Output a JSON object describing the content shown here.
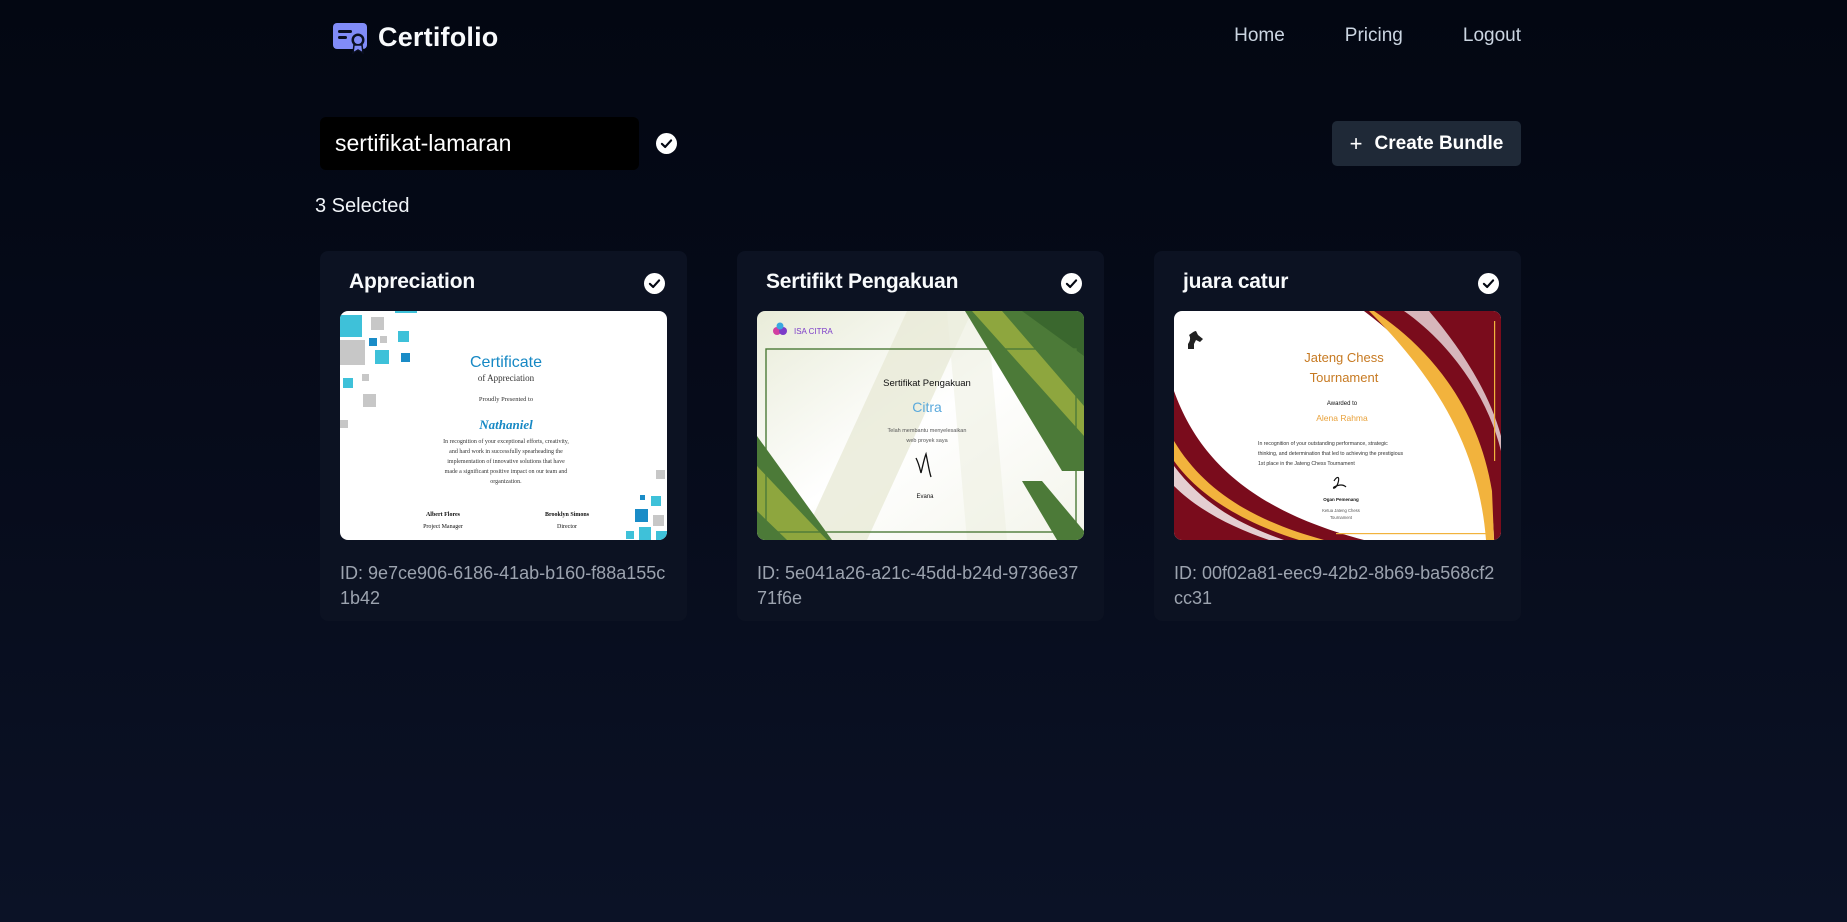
{
  "brand": {
    "name": "Certifolio",
    "icon": "certificate-icon"
  },
  "nav": {
    "items": [
      {
        "label": "Home"
      },
      {
        "label": "Pricing"
      },
      {
        "label": "Logout"
      }
    ]
  },
  "bundle": {
    "name_value": "sertifikat-lamaran",
    "create_label": "Create Bundle",
    "selected_text": "3 Selected"
  },
  "cards": [
    {
      "title": "Appreciation",
      "id_text": "ID: 9e7ce906-6186-41ab-b160-f88a155c1b42",
      "selected": true,
      "preview": {
        "heading": "Certificate",
        "subheading": "of Appreciation",
        "presented": "Proudly Presented to",
        "recipient": "Nathaniel",
        "body": [
          "In recognition of your exceptional efforts, creativity,",
          "and hard work in successfully spearheading the",
          "implementation of innovative solutions that have",
          "made a significant positive impact on our team and",
          "organization."
        ],
        "signer1_name": "Albert Flores",
        "signer1_role": "Project Manager",
        "signer2_name": "Brooklyn Simons",
        "signer2_role": "Director"
      }
    },
    {
      "title": "Sertifikt Pengakuan",
      "id_text": "ID: 5e041a26-a21c-45dd-b24d-9736e3771f6e",
      "selected": true,
      "preview": {
        "org": "ISA CITRA",
        "heading": "Sertifikat Pengakuan",
        "recipient": "Citra",
        "body": [
          "Telah membantu menyelesaikan",
          "web proyek saya"
        ],
        "signer": "Evana"
      }
    },
    {
      "title": "juara catur",
      "id_text": "ID: 00f02a81-eec9-42b2-8b69-ba568cf2cc31",
      "selected": true,
      "preview": {
        "heading1": "Jateng Chess",
        "heading2": "Tournament",
        "awarded": "Awarded to",
        "recipient": "Alena Rahma",
        "body": [
          "In recognition of your outstanding performance, strategic",
          "thinking, and determination that led to achieving the prestigious",
          "1st place in the Jateng Chess Tournament"
        ],
        "signer": "Ogan Pemenang",
        "signer_role": [
          "Ketua Jateng Chess",
          "Tournament"
        ]
      }
    }
  ],
  "colors": {
    "accent": "#818cf8",
    "card_bg": "#0c1222",
    "button_bg": "#1f2937",
    "id_text": "#9ca3af"
  }
}
